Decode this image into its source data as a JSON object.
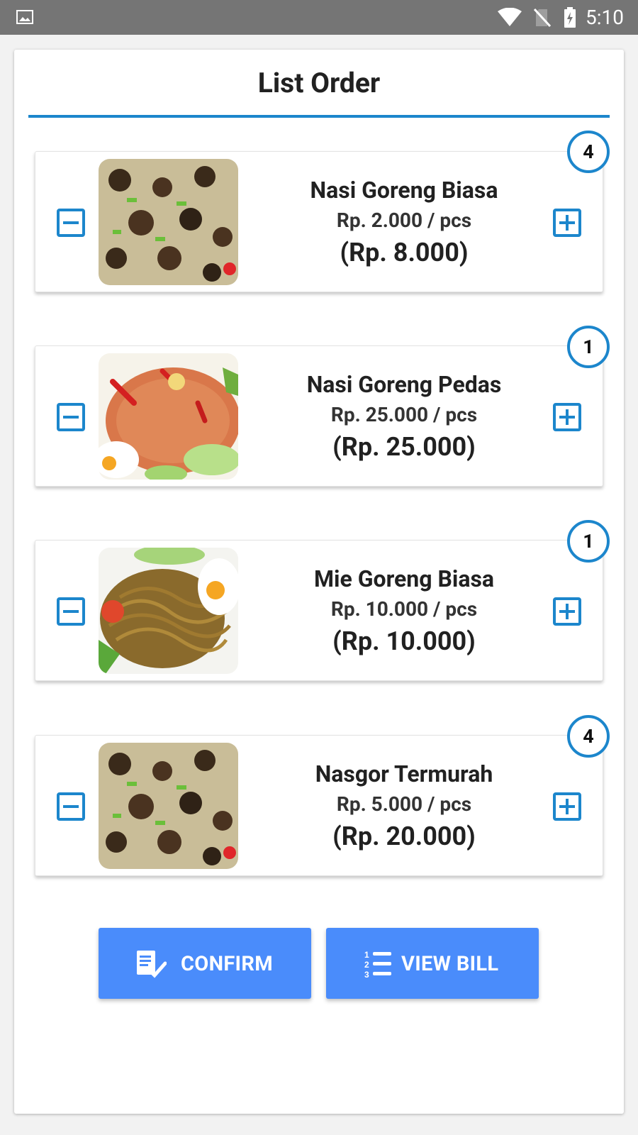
{
  "status_bar": {
    "time": "5:10",
    "icons": [
      "image-icon",
      "wifi-icon",
      "no-sim-icon",
      "battery-charging-icon"
    ]
  },
  "header": {
    "title": "List Order"
  },
  "colors": {
    "accent": "#1c86cc",
    "button": "#4a8cfb",
    "text": "#212121"
  },
  "orders": [
    {
      "name": "Nasi Goreng Biasa",
      "unit_price": "Rp. 2.000 / pcs",
      "total": "(Rp. 8.000)",
      "qty": "4",
      "image": "fried-rice-with-meat"
    },
    {
      "name": "Nasi Goreng Pedas",
      "unit_price": "Rp. 25.000 / pcs",
      "total": "(Rp. 25.000)",
      "qty": "1",
      "image": "spicy-fried-rice"
    },
    {
      "name": "Mie Goreng Biasa",
      "unit_price": "Rp. 10.000 / pcs",
      "total": "(Rp. 10.000)",
      "qty": "1",
      "image": "fried-noodles"
    },
    {
      "name": "Nasgor Termurah",
      "unit_price": "Rp. 5.000 / pcs",
      "total": "(Rp. 20.000)",
      "qty": "4",
      "image": "fried-rice-with-meat"
    }
  ],
  "actions": {
    "confirm_label": "CONFIRM",
    "view_bill_label": "VIEW BILL"
  }
}
